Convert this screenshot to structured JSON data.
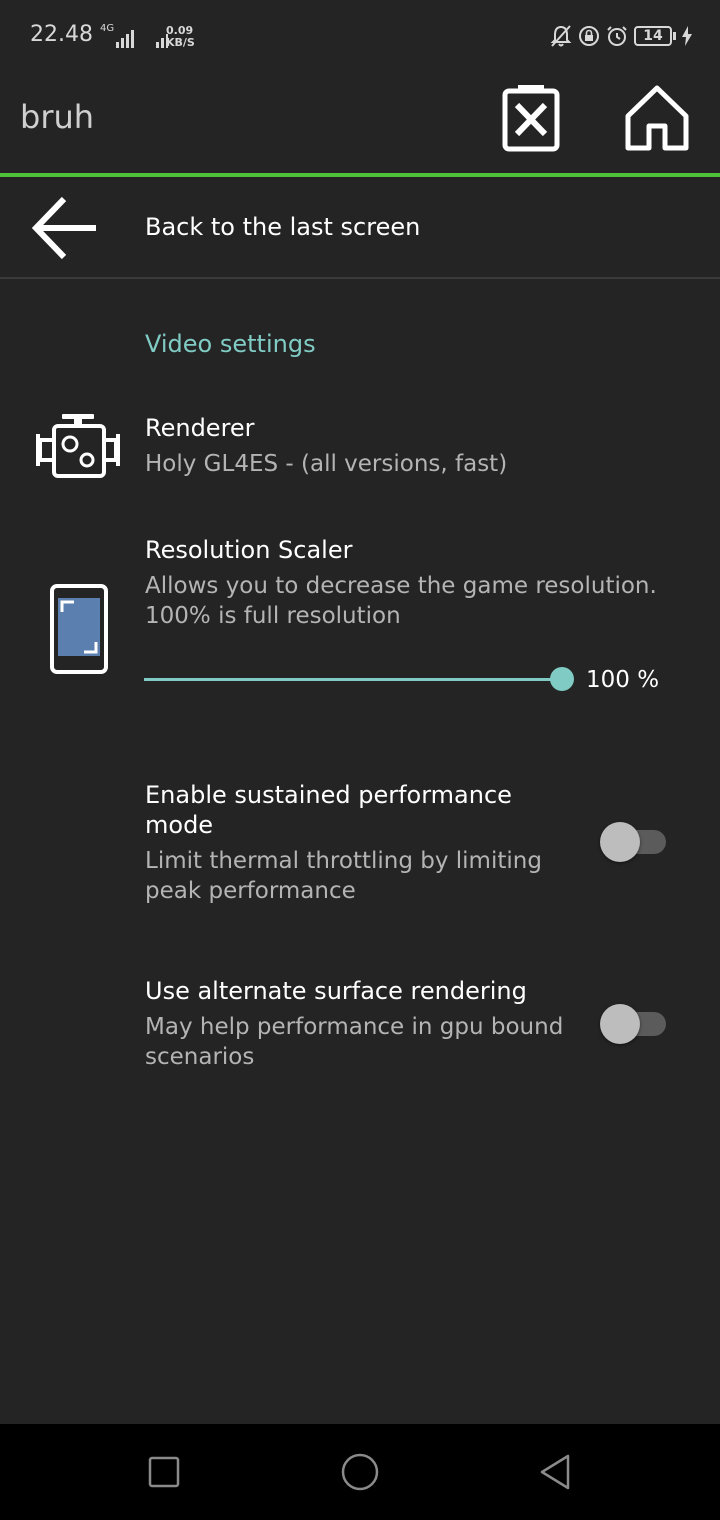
{
  "status_bar": {
    "time": "22.48",
    "network": "4G",
    "speed_value": "0.09",
    "speed_unit": "KB/S",
    "battery": "14"
  },
  "app_bar": {
    "title": "bruh",
    "icons": [
      "delete-icon",
      "home-icon"
    ],
    "accent_color": "#4fc23a"
  },
  "back_row": {
    "label": "Back to the last screen"
  },
  "section": {
    "title": "Video settings",
    "title_color": "#80cbc4"
  },
  "renderer": {
    "title": "Renderer",
    "summary": "Holy GL4ES - (all versions, fast)"
  },
  "resolution_scaler": {
    "title": "Resolution Scaler",
    "summary_line1": "Allows you to decrease the game resolution.",
    "summary_line2": "100% is full resolution",
    "value": 100,
    "value_label": "100 %"
  },
  "sustained_performance": {
    "title_line1": "Enable sustained performance",
    "title_line2": "mode",
    "summary_line1": "Limit thermal throttling by limiting",
    "summary_line2": "peak performance",
    "enabled": false
  },
  "alternate_surface": {
    "title": "Use alternate surface rendering",
    "summary_line1": "May help performance in gpu bound",
    "summary_line2": "scenarios",
    "enabled": false
  },
  "nav_bar": {
    "buttons": [
      "recent-apps",
      "home",
      "back"
    ]
  }
}
